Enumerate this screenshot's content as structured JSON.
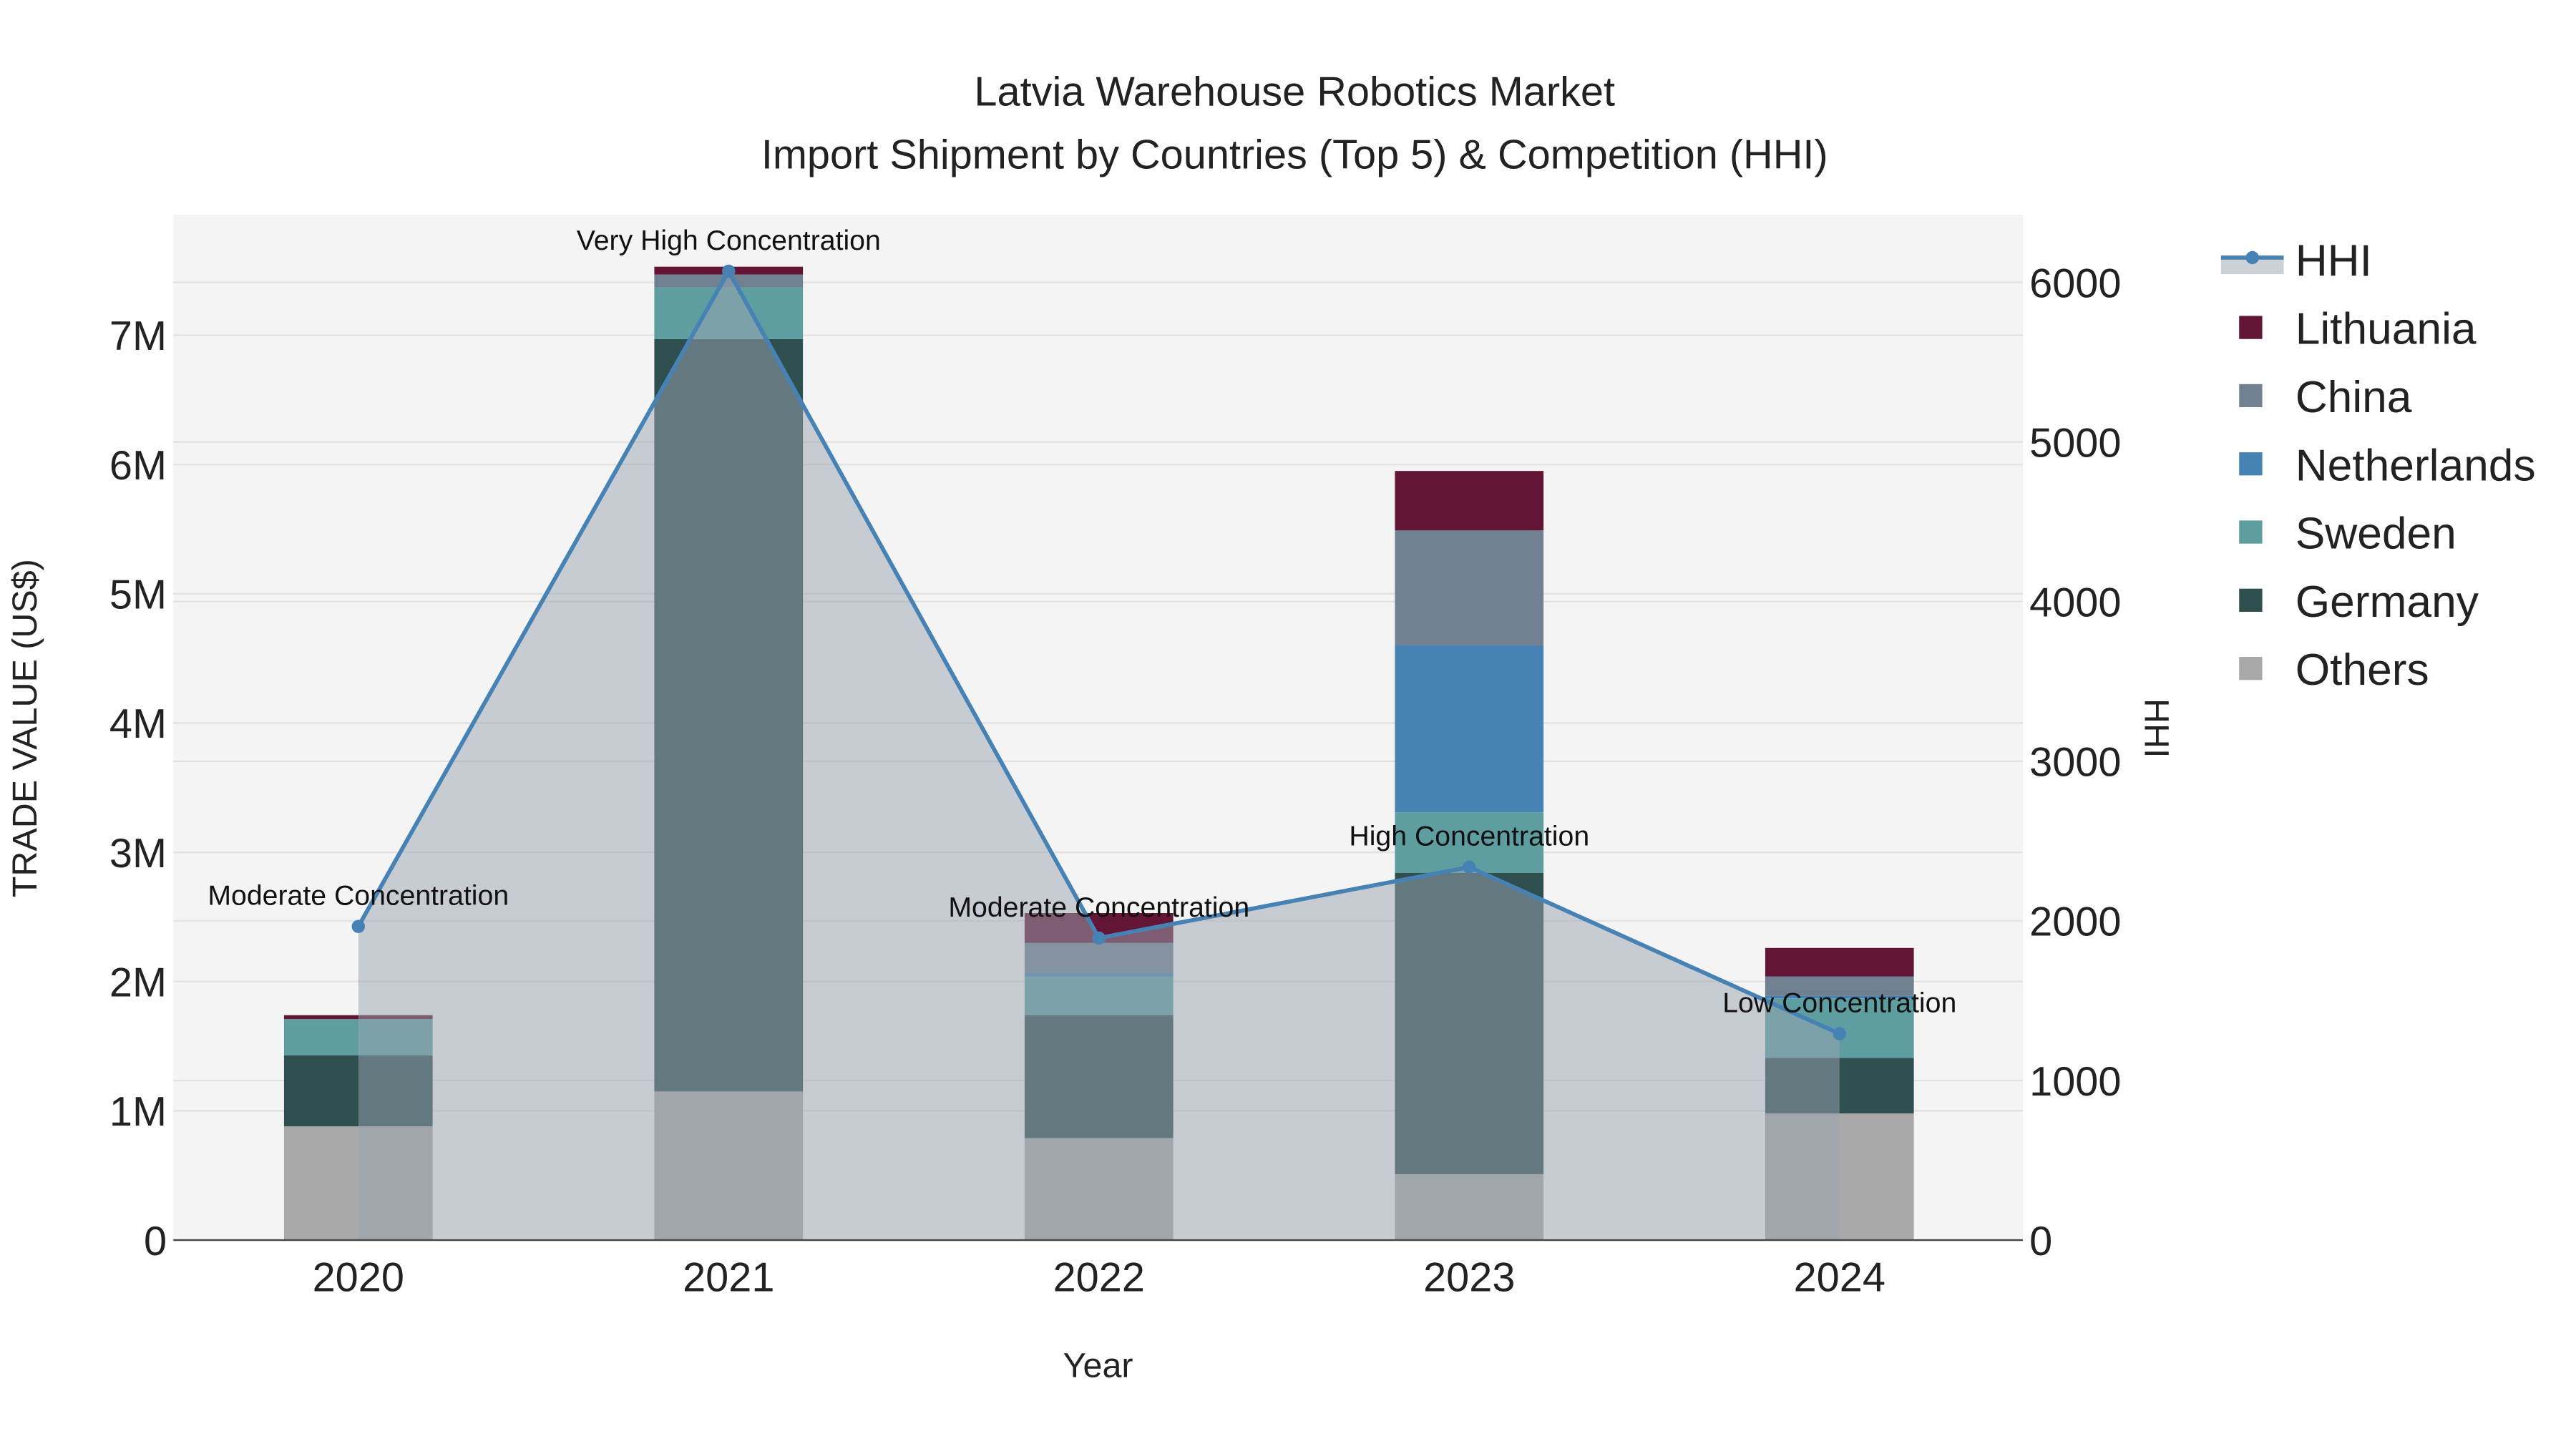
{
  "chart_data": {
    "type": "bar",
    "title": "Latvia Warehouse Robotics Market",
    "subtitle": "Import Shipment by Countries (Top 5) & Competition (HHI)",
    "xlabel": "Year",
    "ylabel": "TRADE VALUE (US$)",
    "y2label": "HHI",
    "ylim": [
      0,
      7800000
    ],
    "y2lim": [
      0,
      6400
    ],
    "yticks": [
      {
        "v": 0,
        "label": "0"
      },
      {
        "v": 1000000,
        "label": "1M"
      },
      {
        "v": 2000000,
        "label": "2M"
      },
      {
        "v": 3000000,
        "label": "3M"
      },
      {
        "v": 4000000,
        "label": "4M"
      },
      {
        "v": 5000000,
        "label": "5M"
      },
      {
        "v": 6000000,
        "label": "6M"
      },
      {
        "v": 7000000,
        "label": "7M"
      }
    ],
    "y2ticks": [
      {
        "v": 0,
        "label": "0"
      },
      {
        "v": 1000,
        "label": "1000"
      },
      {
        "v": 2000,
        "label": "2000"
      },
      {
        "v": 3000,
        "label": "3000"
      },
      {
        "v": 4000,
        "label": "4000"
      },
      {
        "v": 5000,
        "label": "5000"
      },
      {
        "v": 6000,
        "label": "6000"
      }
    ],
    "categories": [
      "2020",
      "2021",
      "2022",
      "2023",
      "2024"
    ],
    "series": [
      {
        "name": "Others",
        "color": "#A9A9A9",
        "values": [
          880000,
          1150000,
          790000,
          510000,
          980000
        ]
      },
      {
        "name": "Germany",
        "color": "#2F4F4F",
        "values": [
          550000,
          5820000,
          950000,
          2330000,
          430000
        ]
      },
      {
        "name": "Sweden",
        "color": "#5F9EA0",
        "values": [
          280000,
          400000,
          300000,
          470000,
          460000
        ]
      },
      {
        "name": "Netherlands",
        "color": "#4682B4",
        "values": [
          0,
          0,
          30000,
          1290000,
          20000
        ]
      },
      {
        "name": "China",
        "color": "#708090",
        "values": [
          0,
          100000,
          230000,
          890000,
          150000
        ]
      },
      {
        "name": "Lithuania",
        "color": "#631535",
        "values": [
          30000,
          60000,
          230000,
          460000,
          220000
        ]
      }
    ],
    "hhi": {
      "name": "HHI",
      "color": "#4682B4",
      "values": [
        1965,
        6070,
        1892,
        2337,
        1293
      ],
      "annotations": [
        "Moderate Concentration",
        "Very High Concentration",
        "Moderate Concentration",
        "High Concentration",
        "Low Concentration"
      ]
    },
    "legend_order": [
      "HHI",
      "Lithuania",
      "China",
      "Netherlands",
      "Sweden",
      "Germany",
      "Others"
    ],
    "legend_placement": "top-right",
    "grid": true
  }
}
